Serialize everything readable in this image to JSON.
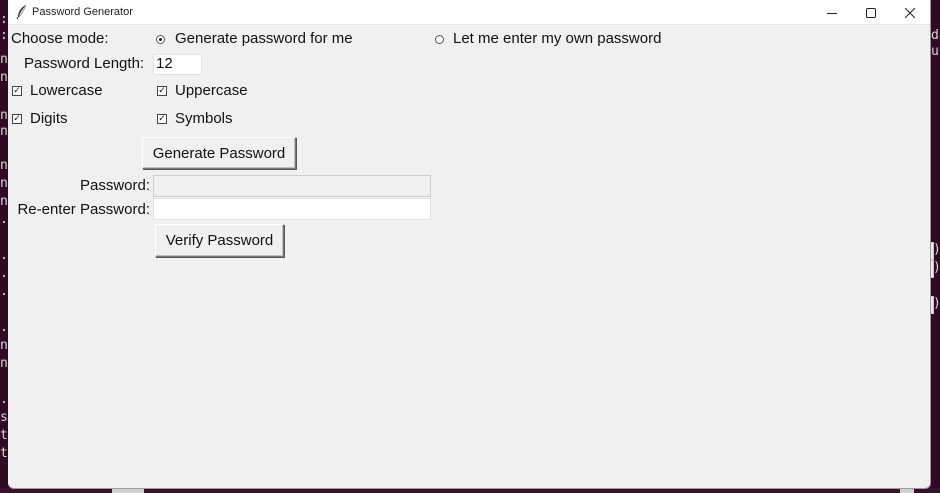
{
  "window": {
    "title": "Password Generator"
  },
  "mode": {
    "label": "Choose mode:",
    "options": [
      {
        "label": "Generate password for me",
        "selected": true
      },
      {
        "label": "Let me enter my own password",
        "selected": false
      }
    ]
  },
  "length": {
    "label": "Password Length:",
    "value": "12"
  },
  "options": {
    "lowercase": {
      "label": "Lowercase",
      "checked": true
    },
    "uppercase": {
      "label": "Uppercase",
      "checked": true
    },
    "digits": {
      "label": "Digits",
      "checked": true
    },
    "symbols": {
      "label": "Symbols",
      "checked": true
    },
    "check_mark": "✓"
  },
  "buttons": {
    "generate": "Generate Password",
    "verify": "Verify Password"
  },
  "password": {
    "label": "Password:",
    "value": "",
    "disabled": true
  },
  "reenter": {
    "label": "Re-enter Password:",
    "value": ""
  },
  "background_terminal": {
    "left_chars": [
      ":",
      ":",
      "n",
      "n",
      "n",
      "n",
      "n",
      "n",
      "n",
      ".",
      ".",
      ".",
      ".",
      ".",
      "n",
      "n",
      ".",
      "s",
      "t",
      "t"
    ],
    "right_chars": [
      "da",
      "up",
      ")",
      ")",
      ")"
    ]
  },
  "colors": {
    "window_bg": "#f0f0f0",
    "terminal_bg": "#300a24"
  }
}
